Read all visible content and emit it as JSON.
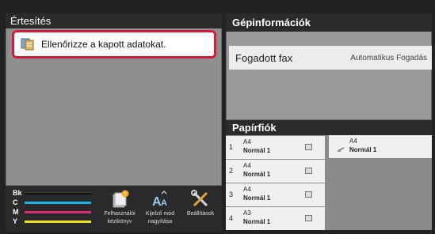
{
  "notifications": {
    "title": "Értesítés",
    "message": "Ellenőrizze a kapott adatokat.",
    "icon": "document-check-icon"
  },
  "toner": [
    {
      "label": "Bk",
      "color": "#111111",
      "fill": 1.0
    },
    {
      "label": "C",
      "color": "#19b6e6",
      "fill": 1.0
    },
    {
      "label": "M",
      "color": "#e0287a",
      "fill": 1.0
    },
    {
      "label": "Y",
      "color": "#f2e21b",
      "fill": 1.0
    }
  ],
  "toolbar": {
    "manual": {
      "label_line1": "Felhasználói",
      "label_line2": "kézikönyv",
      "icon": "user-manual-icon"
    },
    "zoom": {
      "label_line1": "Kijelző mód",
      "label_line2": "nagyítása",
      "icon": "display-zoom-icon"
    },
    "settings": {
      "label_line1": "Beállítások",
      "icon": "tools-icon"
    }
  },
  "machine_info": {
    "title": "Gépinformációk",
    "fax_label": "Fogadott fax",
    "fax_value": "Automatikus Fogadás"
  },
  "trays": {
    "title": "Papírfiók",
    "items": [
      {
        "num": "1",
        "size": "A4",
        "type": "Normál 1"
      },
      {
        "num": "2",
        "size": "A4",
        "type": "Normál 1"
      },
      {
        "num": "3",
        "size": "A4",
        "type": "Normál 1"
      },
      {
        "num": "4",
        "size": "A3",
        "type": "Normál 1"
      }
    ],
    "bypass": {
      "size": "A4",
      "type": "Normál 1"
    }
  },
  "colors": {
    "highlight_border": "#d21c3a",
    "panel_header": "#2b2b2b"
  }
}
